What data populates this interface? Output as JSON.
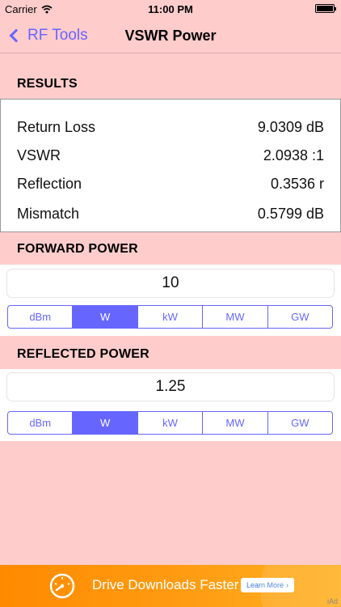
{
  "status_bar": {
    "carrier": "Carrier",
    "time": "11:00 PM"
  },
  "nav": {
    "back_label": "RF Tools",
    "title": "VSWR Power"
  },
  "results": {
    "header": "RESULTS",
    "rows": [
      {
        "label": "Return Loss",
        "value": "9.0309 dB"
      },
      {
        "label": "VSWR",
        "value": "2.0938 :1"
      },
      {
        "label": "Reflection",
        "value": "0.3536 r"
      },
      {
        "label": "Mismatch",
        "value": "0.5799 dB"
      }
    ]
  },
  "forward": {
    "header": "FORWARD POWER",
    "value": "10",
    "units": [
      "dBm",
      "W",
      "kW",
      "MW",
      "GW"
    ],
    "selected_unit": "W"
  },
  "reflected": {
    "header": "REFLECTED POWER",
    "value": "1.25",
    "units": [
      "dBm",
      "W",
      "kW",
      "MW",
      "GW"
    ],
    "selected_unit": "W"
  },
  "ad": {
    "text": "Drive Downloads Faster",
    "button": "Learn More",
    "label": "iAd"
  },
  "colors": {
    "background": "#ffcccc",
    "accent": "#6666ff",
    "ad_orange": "#ff9c12"
  }
}
